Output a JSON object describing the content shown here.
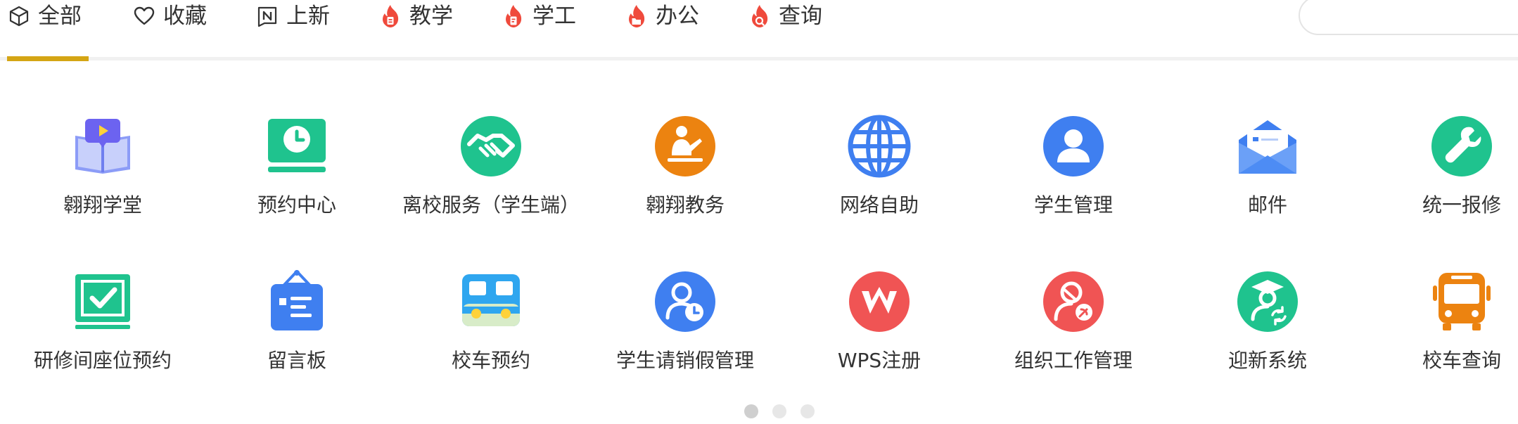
{
  "tabs": [
    {
      "label": "全部",
      "icon": "cube-icon",
      "active": true
    },
    {
      "label": "收藏",
      "icon": "heart-icon"
    },
    {
      "label": "上新",
      "icon": "new-badge-icon"
    },
    {
      "label": "教学",
      "icon": "flame-icon"
    },
    {
      "label": "学工",
      "icon": "flame-icon"
    },
    {
      "label": "办公",
      "icon": "flame-icon"
    },
    {
      "label": "查询",
      "icon": "flame-icon"
    }
  ],
  "search": {
    "placeholder": ""
  },
  "apps_row1": [
    {
      "label": "翱翔学堂",
      "icon": "open-book-video-icon"
    },
    {
      "label": "预约中心",
      "icon": "clock-monitor-icon"
    },
    {
      "label": "离校服务（学生端）",
      "icon": "handshake-icon"
    },
    {
      "label": "翱翔教务",
      "icon": "teacher-icon"
    },
    {
      "label": "网络自助",
      "icon": "globe-icon"
    },
    {
      "label": "学生管理",
      "icon": "person-icon"
    },
    {
      "label": "邮件",
      "icon": "mail-icon"
    },
    {
      "label": "统一报修",
      "icon": "wrench-icon"
    }
  ],
  "apps_row2": [
    {
      "label": "研修间座位预约",
      "icon": "checkbox-icon"
    },
    {
      "label": "留言板",
      "icon": "message-board-icon"
    },
    {
      "label": "校车预约",
      "icon": "bus-icon"
    },
    {
      "label": "学生请销假管理",
      "icon": "person-clock-icon"
    },
    {
      "label": "WPS注册",
      "icon": "wps-icon"
    },
    {
      "label": "组织工作管理",
      "icon": "party-person-icon"
    },
    {
      "label": "迎新系统",
      "icon": "graduate-icon"
    },
    {
      "label": "校车查询",
      "icon": "school-bus-icon"
    }
  ],
  "pagination": {
    "pages": 3,
    "current": 1
  },
  "colors": {
    "accent": "#d4a514",
    "green": "#1fc38e",
    "blue": "#3f7ff0",
    "orange": "#ec8310",
    "red": "#f05454",
    "flame": "#ef4a3c"
  }
}
